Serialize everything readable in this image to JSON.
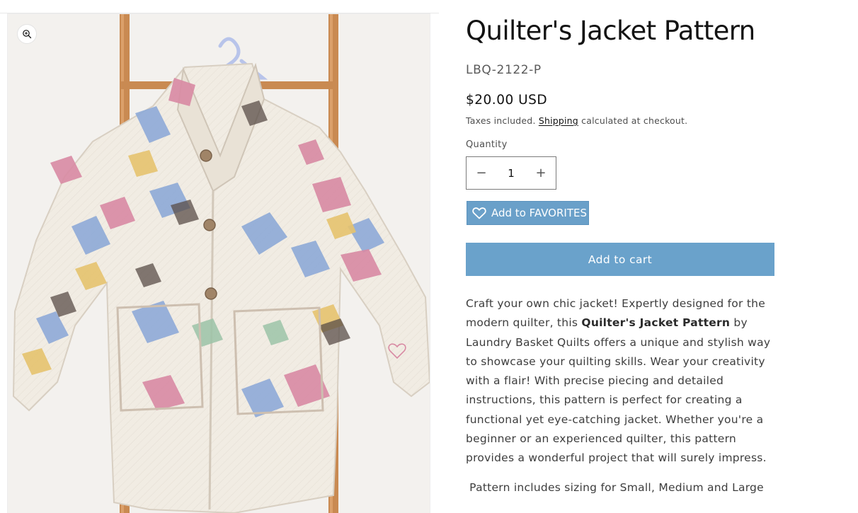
{
  "product": {
    "title": "Quilter's Jacket Pattern",
    "sku": "LBQ-2122-P",
    "price": "$20.00 USD",
    "tax_note": {
      "prefix": "Taxes included.",
      "link": "Shipping",
      "suffix": "calculated at checkout."
    },
    "quantity": {
      "label": "Quantity",
      "value": "1",
      "minus": "−",
      "plus": "+"
    },
    "favorites_label": "Add to FAVORITES",
    "cart_label": "Add to cart",
    "description": {
      "part1": "Craft your own chic jacket! Expertly designed for the modern quilter, this ",
      "bold": "Quilter's Jacket Pattern",
      "part2": " by Laundry Basket Quilts offers a unique and stylish way to showcase your quilting skills. Wear your creativity with a flair! With precise piecing and detailed instructions, this pattern is perfect for creating a functional yet eye-catching jacket. Whether you're a beginner or an experienced quilter, this pattern provides a wonderful project that will surely impress."
    },
    "sizes_note": " Pattern includes sizing for Small, Medium and Large"
  },
  "media": {
    "zoom_icon": "zoom-in-icon",
    "image_subject": "quilted-jacket-on-ladder"
  },
  "colors": {
    "button_blue": "#6aa2cb",
    "text_dark": "#121212",
    "text_muted": "#4f4f4f"
  }
}
